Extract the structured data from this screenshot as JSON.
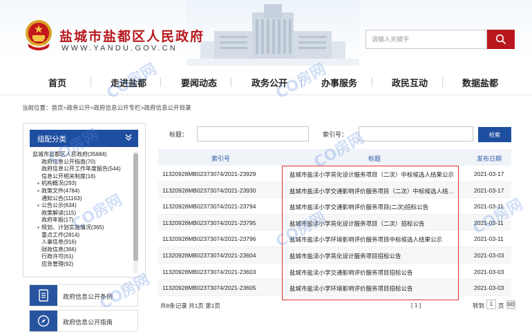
{
  "header": {
    "site_title": "盐城市盐都区人民政府",
    "site_url": "WWW.YANDU.GOV.CN",
    "search_placeholder": "请输入关键字",
    "emblem_icon": "national-emblem-icon",
    "search_icon": "search-icon",
    "accent_color": "#b8171d"
  },
  "nav": {
    "items": [
      "首页",
      "走进盐都",
      "要闻动态",
      "政务公开",
      "办事服务",
      "政民互动",
      "数据盐都"
    ]
  },
  "breadcrumb": {
    "prefix": "当前位置：",
    "items": [
      "首页",
      "政务公开",
      "政府信息公开专栏",
      "政府信息公开目录"
    ],
    "separator": ">"
  },
  "sidebar": {
    "title": "组配分类",
    "chevron_icon": "double-chevron-down-icon",
    "tree": [
      {
        "label": "盐城市盐都区人民政府(35684)",
        "level": 0,
        "toggle": ""
      },
      {
        "label": "政府信息公开指南(70)",
        "level": 1,
        "toggle": ""
      },
      {
        "label": "政府信息公开工作年度报告(544)",
        "level": 1,
        "toggle": ""
      },
      {
        "label": "信息公开相关制度(16)",
        "level": 1,
        "toggle": ""
      },
      {
        "label": "机构概况(293)",
        "level": 1,
        "toggle": "+"
      },
      {
        "label": "政策文件(4784)",
        "level": 1,
        "toggle": "+"
      },
      {
        "label": "通知公告(11163)",
        "level": 1,
        "toggle": ""
      },
      {
        "label": "公告公示(634)",
        "level": 1,
        "toggle": "+"
      },
      {
        "label": "政策解读(115)",
        "level": 1,
        "toggle": ""
      },
      {
        "label": "政府年报(17)",
        "level": 1,
        "toggle": ""
      },
      {
        "label": "规划、计划实施情况(365)",
        "level": 1,
        "toggle": "+"
      },
      {
        "label": "重点工作(2814)",
        "level": 1,
        "toggle": ""
      },
      {
        "label": "人事信息(916)",
        "level": 1,
        "toggle": ""
      },
      {
        "label": "财政信息(366)",
        "level": 1,
        "toggle": ""
      },
      {
        "label": "行政许可(61)",
        "level": 1,
        "toggle": ""
      },
      {
        "label": "应急管理(92)",
        "level": 1,
        "toggle": ""
      }
    ],
    "quick_links": [
      {
        "label": "政府信息公开条例",
        "icon": "document-list-icon"
      },
      {
        "label": "政府信息公开指南",
        "icon": "compass-icon"
      }
    ]
  },
  "search_form": {
    "title_label": "标题：",
    "index_label": "索引号：",
    "title_value": "",
    "index_value": "",
    "submit_label": "检索"
  },
  "table": {
    "columns": [
      "索引号",
      "标题",
      "发布日期"
    ],
    "rows": [
      {
        "index": "11320928MB02373074/2021-23929",
        "title": "盐城市盐渎小学亮化设计服务项目（二次）中标候选人结果公示",
        "date": "2021-03-17"
      },
      {
        "index": "11320928MB02373074/2021-23930",
        "title": "盐城市盐渎小学交通影响评价服务项目（二次）中标候选人结果公示",
        "date": "2021-03-17"
      },
      {
        "index": "11320928MB02373074/2021-23794",
        "title": "盐城市盐渎小学交通影响评价服务项目(二次)招标公告",
        "date": "2021-03-11"
      },
      {
        "index": "11320928MB02373074/2021-23795",
        "title": "盐城市盐渎小学亮化设计服务项目（二次）招标公告",
        "date": "2021-03-11"
      },
      {
        "index": "11320928MB02373074/2021-23796",
        "title": "盐城市盐渎小学环境影响评价服务项目中标候选人结果公示",
        "date": "2021-03-11"
      },
      {
        "index": "11320928MB02373074/2021-23604",
        "title": "盐城市盐渎小学亮化设计服务项目招标公告",
        "date": "2021-03-03"
      },
      {
        "index": "11320928MB02373074/2021-23603",
        "title": "盐城市盐渎小学交通影响评价服务项目招标公告",
        "date": "2021-03-03"
      },
      {
        "index": "11320928MB02373074/2021-23605",
        "title": "盐城市盐渎小学环境影响评价服务项目招标公告",
        "date": "2021-03-03"
      }
    ]
  },
  "pager": {
    "summary": "共8条记录  共1页  第1页",
    "current": "[ 1 ]",
    "goto_label": "转到",
    "page_value": "1",
    "page_unit": "页",
    "go_label": "GO"
  },
  "watermark": {
    "text": "CO房网"
  }
}
